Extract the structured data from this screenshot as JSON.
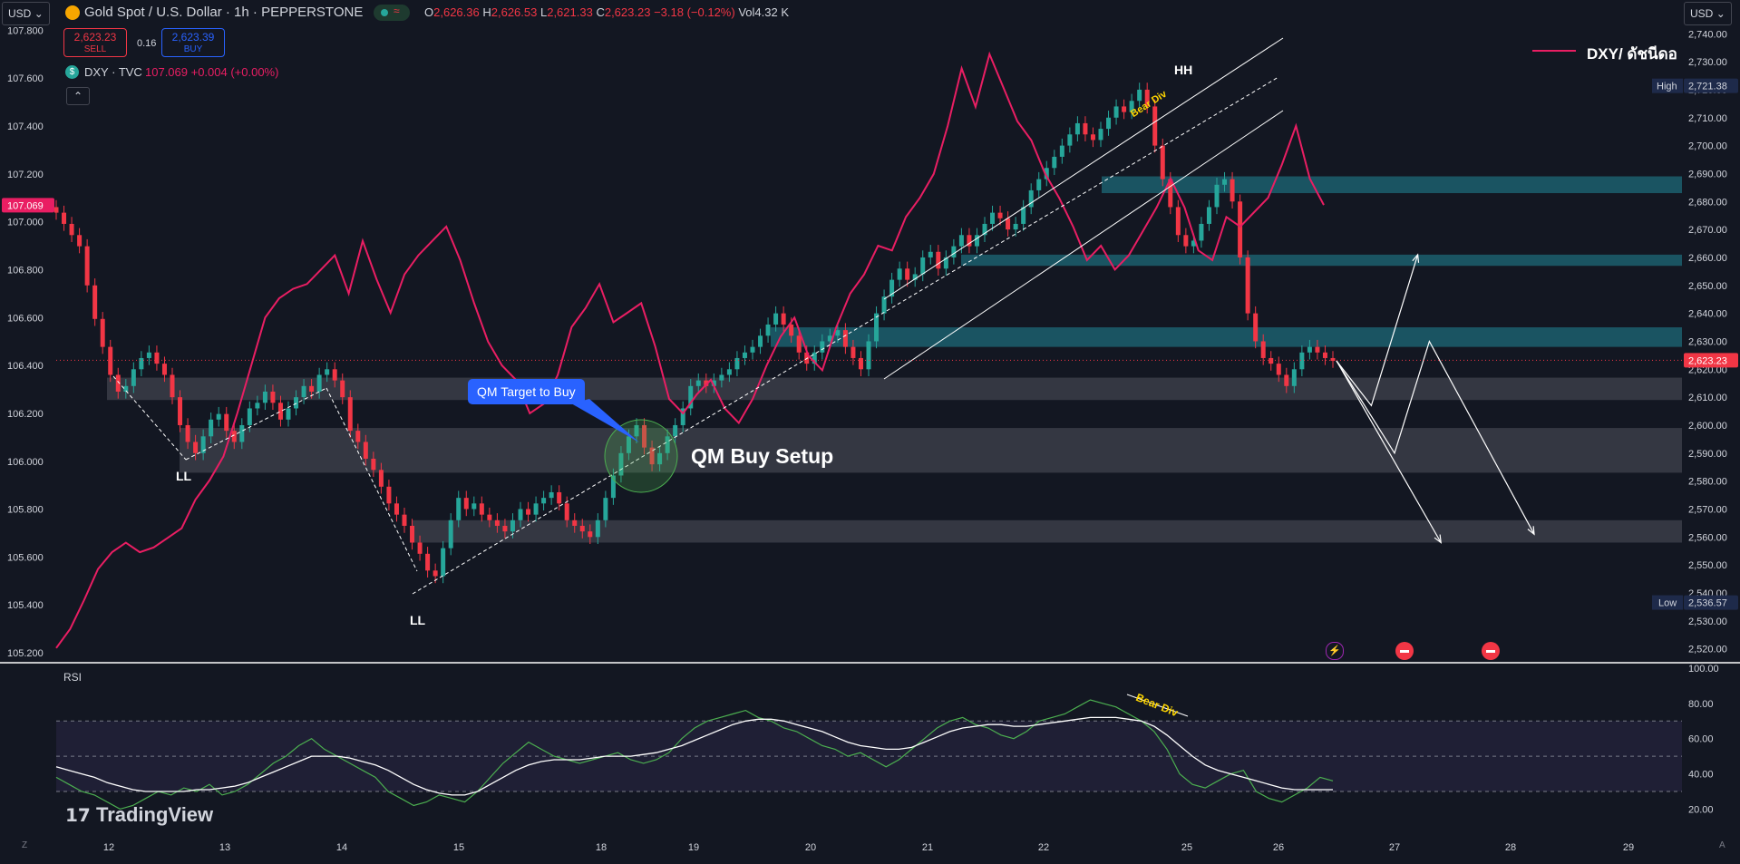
{
  "header": {
    "currency_left": "USD",
    "currency_right": "USD",
    "title": "Gold Spot / U.S. Dollar · 1h · PEPPERSTONE",
    "ohlc": [
      {
        "k": "O",
        "v": "2,626.36"
      },
      {
        "k": "H",
        "v": "2,626.53"
      },
      {
        "k": "L",
        "v": "2,621.33"
      },
      {
        "k": "C",
        "v": "2,623.23"
      },
      {
        "k": "",
        "v": "−3.18 (−0.12%)"
      },
      {
        "k": "Vol",
        "v": "4.32 K"
      }
    ],
    "sell_price": "2,623.23",
    "sell_label": "SELL",
    "spread": "0.16",
    "buy_price": "2,623.39",
    "buy_label": "BUY",
    "overlay_symbol": "DXY · TVC",
    "overlay_value": "107.069 +0.004 (+0.00%)",
    "collapse_icon": "chevron-up-icon"
  },
  "legend": {
    "label": "DXY/ ดัชนีดอ"
  },
  "labels": {
    "qm_target": "QM Target to Buy",
    "qm_setup": "QM Buy Setup",
    "ll1": "LL",
    "ll2": "LL",
    "hh": "HH",
    "bear_div_price": "Bear Div",
    "bear_div_rsi": "Bear Div",
    "rsi_title": "RSI",
    "logo": "TradingView"
  },
  "colors": {
    "bg": "#131722",
    "up": "#26a69a",
    "down": "#f23645",
    "dxy": "#e91e63",
    "rsi": "#4caf50",
    "rsi_ma": "#ffffff",
    "zone_teal": "#1e6a78",
    "zone_grey": "#5d606b",
    "callout": "#2962ff"
  },
  "chart_data": [
    {
      "type": "line",
      "title": "Gold Spot / U.S. Dollar · 1h · PEPPERSTONE",
      "x": [
        12,
        13,
        14,
        15,
        18,
        19,
        20,
        21,
        22,
        25,
        26,
        27,
        28,
        29
      ],
      "x_tick_labels": [
        "12",
        "13",
        "14",
        "15",
        "18",
        "19",
        "20",
        "21",
        "22",
        "25",
        "26",
        "27",
        "28",
        "29"
      ],
      "right_axis": {
        "ticks": [
          "2,740.00",
          "2,730.00",
          "2,720.00",
          "2,710.00",
          "2,700.00",
          "2,690.00",
          "2,680.00",
          "2,670.00",
          "2,660.00",
          "2,650.00",
          "2,640.00",
          "2,630.00",
          "2,620.00",
          "2,610.00",
          "2,600.00",
          "2,590.00",
          "2,580.00",
          "2,570.00",
          "2,560.00",
          "2,550.00",
          "2,540.00",
          "2,530.00",
          "2,520.00"
        ],
        "ylim": [
          2516,
          2743
        ]
      },
      "left_axis": {
        "ticks": [
          "107.800",
          "107.600",
          "107.400",
          "107.200",
          "107.000",
          "106.800",
          "106.600",
          "106.400",
          "106.200",
          "106.000",
          "105.800",
          "105.600",
          "105.400",
          "105.200"
        ],
        "ylim": [
          105.17,
          107.82
        ]
      },
      "series": [
        {
          "name": "XAUUSD",
          "style": "candles",
          "closes": [
            2676,
            2672,
            2668,
            2664,
            2650,
            2638,
            2628,
            2618,
            2612,
            2614,
            2620,
            2624,
            2626,
            2622,
            2618,
            2610,
            2600,
            2594,
            2590,
            2596,
            2602,
            2604,
            2598,
            2594,
            2600,
            2606,
            2608,
            2612,
            2608,
            2602,
            2606,
            2610,
            2614,
            2612,
            2618,
            2620,
            2616,
            2610,
            2598,
            2594,
            2588,
            2584,
            2578,
            2572,
            2568,
            2564,
            2558,
            2554,
            2548,
            2546,
            2556,
            2566,
            2574,
            2570,
            2572,
            2568,
            2566,
            2564,
            2562,
            2566,
            2570,
            2568,
            2572,
            2574,
            2576,
            2572,
            2566,
            2564,
            2562,
            2560,
            2566,
            2574,
            2582,
            2590,
            2596,
            2600,
            2592,
            2586,
            2590,
            2596,
            2600,
            2606,
            2614,
            2616,
            2614,
            2616,
            2618,
            2620,
            2624,
            2626,
            2628,
            2632,
            2636,
            2640,
            2636,
            2632,
            2626,
            2622,
            2626,
            2630,
            2632,
            2634,
            2628,
            2624,
            2620,
            2630,
            2640,
            2646,
            2652,
            2656,
            2652,
            2654,
            2660,
            2662,
            2656,
            2660,
            2664,
            2668,
            2664,
            2668,
            2672,
            2676,
            2674,
            2670,
            2672,
            2678,
            2684,
            2688,
            2692,
            2696,
            2700,
            2704,
            2708,
            2704,
            2702,
            2706,
            2710,
            2714,
            2712,
            2716,
            2720,
            2714,
            2700,
            2688,
            2678,
            2668,
            2664,
            2666,
            2672,
            2678,
            2686,
            2688,
            2680,
            2660,
            2640,
            2630,
            2624,
            2622,
            2618,
            2614,
            2620,
            2626,
            2628,
            2626,
            2624,
            2623
          ],
          "ohlc": {
            "open": 2626.36,
            "high": 2626.53,
            "low": 2621.33,
            "close": 2623.23
          },
          "high_marker": 2721.38,
          "low_marker": 2536.57,
          "last": 2623.23
        },
        {
          "name": "DXY · TVC",
          "style": "line",
          "values": [
            105.22,
            105.3,
            105.42,
            105.55,
            105.62,
            105.66,
            105.62,
            105.64,
            105.68,
            105.72,
            105.84,
            105.92,
            106.02,
            106.2,
            106.4,
            106.6,
            106.68,
            106.72,
            106.74,
            106.8,
            106.86,
            106.7,
            106.92,
            106.76,
            106.62,
            106.78,
            106.86,
            106.92,
            106.98,
            106.84,
            106.66,
            106.5,
            106.4,
            106.34,
            106.2,
            106.24,
            106.36,
            106.56,
            106.64,
            106.74,
            106.58,
            106.62,
            106.66,
            106.48,
            106.26,
            106.2,
            106.28,
            106.34,
            106.22,
            106.16,
            106.26,
            106.4,
            106.52,
            106.6,
            106.44,
            106.38,
            106.56,
            106.7,
            106.78,
            106.9,
            106.88,
            107.02,
            107.1,
            107.2,
            107.4,
            107.64,
            107.48,
            107.7,
            107.56,
            107.42,
            107.34,
            107.2,
            107.1,
            106.98,
            106.84,
            106.9,
            106.8,
            106.86,
            106.96,
            107.06,
            107.18,
            107.06,
            106.88,
            106.84,
            107.02,
            106.98,
            107.04,
            107.1,
            107.24,
            107.4,
            107.18,
            107.07
          ],
          "last": 107.069
        }
      ],
      "zones": [
        {
          "top": 2689,
          "bottom": 2683,
          "kind": "resistance"
        },
        {
          "top": 2661,
          "bottom": 2657,
          "kind": "resistance"
        },
        {
          "top": 2635,
          "bottom": 2628,
          "kind": "resistance"
        },
        {
          "top": 2617,
          "bottom": 2609,
          "kind": "support"
        },
        {
          "top": 2599,
          "bottom": 2583,
          "kind": "support"
        },
        {
          "top": 2566,
          "bottom": 2558,
          "kind": "support"
        }
      ],
      "projection_paths": [
        [
          [
            26.5,
            2623
          ],
          [
            26.8,
            2607
          ],
          [
            27.2,
            2661
          ]
        ],
        [
          [
            26.5,
            2623
          ],
          [
            27.0,
            2590
          ],
          [
            27.3,
            2630
          ],
          [
            28.2,
            2561
          ]
        ],
        [
          [
            26.5,
            2623
          ],
          [
            27.4,
            2558
          ]
        ]
      ]
    },
    {
      "type": "line",
      "title": "RSI",
      "ylim": [
        13,
        100
      ],
      "ticks": [
        "100.00",
        "80.00",
        "60.00",
        "40.00",
        "20.00"
      ],
      "bands": {
        "upper": 70,
        "middle": 50,
        "lower": 30
      },
      "series": [
        {
          "name": "RSI",
          "values": [
            38,
            34,
            30,
            28,
            24,
            20,
            22,
            26,
            30,
            28,
            32,
            30,
            34,
            28,
            30,
            34,
            40,
            46,
            50,
            56,
            60,
            54,
            50,
            46,
            42,
            38,
            30,
            26,
            22,
            24,
            28,
            26,
            24,
            30,
            38,
            46,
            52,
            58,
            54,
            50,
            48,
            46,
            48,
            50,
            52,
            48,
            46,
            48,
            52,
            60,
            66,
            70,
            72,
            74,
            76,
            72,
            70,
            66,
            64,
            60,
            56,
            54,
            50,
            52,
            48,
            44,
            48,
            54,
            60,
            66,
            70,
            72,
            68,
            66,
            62,
            60,
            64,
            70,
            72,
            74,
            78,
            82,
            80,
            78,
            74,
            70,
            64,
            54,
            40,
            34,
            32,
            36,
            40,
            42,
            30,
            26,
            24,
            28,
            32,
            38,
            36
          ]
        },
        {
          "name": "MA",
          "values": [
            44,
            42,
            40,
            38,
            35,
            33,
            31,
            30,
            30,
            30,
            30,
            31,
            31,
            32,
            33,
            35,
            38,
            41,
            44,
            47,
            50,
            50,
            50,
            49,
            47,
            45,
            42,
            38,
            34,
            31,
            29,
            28,
            28,
            30,
            34,
            38,
            42,
            45,
            47,
            48,
            48,
            48,
            49,
            50,
            50,
            50,
            51,
            52,
            54,
            56,
            59,
            62,
            65,
            68,
            70,
            71,
            71,
            70,
            68,
            66,
            64,
            61,
            58,
            56,
            55,
            54,
            54,
            55,
            58,
            61,
            64,
            66,
            67,
            68,
            68,
            67,
            67,
            68,
            69,
            70,
            71,
            72,
            72,
            72,
            71,
            70,
            67,
            62,
            56,
            50,
            45,
            42,
            40,
            38,
            36,
            34,
            32,
            31,
            31,
            31,
            31
          ]
        }
      ]
    }
  ]
}
